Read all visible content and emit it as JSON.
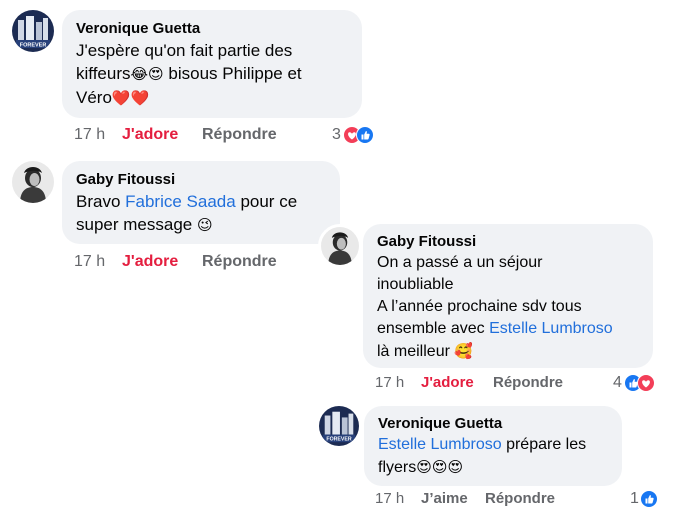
{
  "colors": {
    "bubble": "#f0f2f5",
    "love": "#e41e3f",
    "like": "#1877f2",
    "mention": "#216fdb",
    "meta": "#65676b"
  },
  "comments": [
    {
      "author": "Veronique Guetta",
      "avatar_icon": "forever-logo-avatar",
      "line1": "J'espère qu'on fait partie des",
      "line2_a": "kiffeurs",
      "line2_emoji": "😂😍",
      "line2_b": " bisous Philippe et",
      "line3_a": "Véro",
      "line3_emoji": "❤️❤️",
      "time": "17 h",
      "reaction_label": "J'adore",
      "reply_label": "Répondre",
      "reaction_count": "3",
      "reaction_icons": [
        "love",
        "like"
      ]
    },
    {
      "author": "Gaby Fitoussi",
      "avatar_icon": "person-photo-avatar",
      "line1_a": "Bravo ",
      "line1_mention": "Fabrice Saada",
      "line1_b": " pour ce",
      "line2_a": "super message ",
      "line2_emoji": "😉",
      "time": "17 h",
      "reaction_label": "J'adore",
      "reply_label": "Répondre"
    },
    {
      "author": "Gaby Fitoussi",
      "avatar_icon": "person-photo-avatar",
      "line1": "On a passé a un séjour",
      "line2": "inoubliable",
      "line3": "A l’année prochaine sdv tous",
      "line4_a": "ensemble avec ",
      "line4_mention": "Estelle Lumbroso",
      "line5_a": "là meilleur ",
      "line5_emoji": "🥰",
      "time": "17 h",
      "reaction_label": "J'adore",
      "reply_label": "Répondre",
      "reaction_count": "4",
      "reaction_icons": [
        "like",
        "love"
      ]
    },
    {
      "author": "Veronique Guetta",
      "avatar_icon": "forever-logo-avatar",
      "line1_mention": "Estelle Lumbroso",
      "line1_b": " prépare les",
      "line2_a": "flyers",
      "line2_emoji": "😍😍😍",
      "time": "17 h",
      "reaction_label": "J’aime",
      "reply_label": "Répondre",
      "reaction_count": "1",
      "reaction_icons": [
        "like"
      ]
    }
  ],
  "avatar_logo_text": "FOREVER"
}
